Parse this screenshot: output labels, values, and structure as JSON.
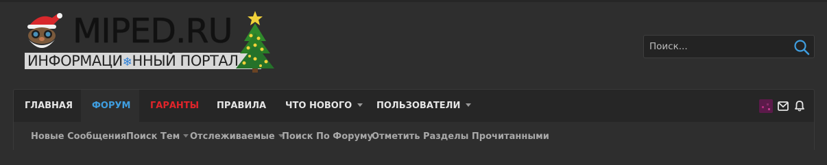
{
  "logo": {
    "title": "MIPED.RU",
    "subtitle_part1": "ИНФОРМАЦИ",
    "subtitle_part2": "ННЫЙ ПОРТАЛ",
    "snowflake": "❄"
  },
  "search": {
    "placeholder": "Поиск...",
    "icon": "search-icon"
  },
  "nav": {
    "tabs": [
      {
        "label": "Главная",
        "color": "#e6e6e6"
      },
      {
        "label": "Форум",
        "color": "#3f9ee0"
      },
      {
        "label": "Гаранты",
        "color": "#e0242a"
      },
      {
        "label": "Правила",
        "color": "#e6e6e6"
      },
      {
        "label": "Что нового",
        "color": "#e6e6e6"
      },
      {
        "label": "Пользователи",
        "color": "#e6e6e6"
      }
    ],
    "icons": [
      "avatar",
      "envelope-icon",
      "bell-icon"
    ]
  },
  "subnav": {
    "items": [
      {
        "label": "Новые Сообщения"
      },
      {
        "label": "Поиск Тем"
      },
      {
        "label": "Отслеживаемые"
      },
      {
        "label": "Поиск По Форуму"
      },
      {
        "label": "Отметить Разделы Прочитанными"
      }
    ]
  },
  "colors": {
    "background": "#2e2e2e",
    "navbar": "#262626",
    "accent": "#3f9ee0",
    "guarantors": "#e0242a"
  }
}
